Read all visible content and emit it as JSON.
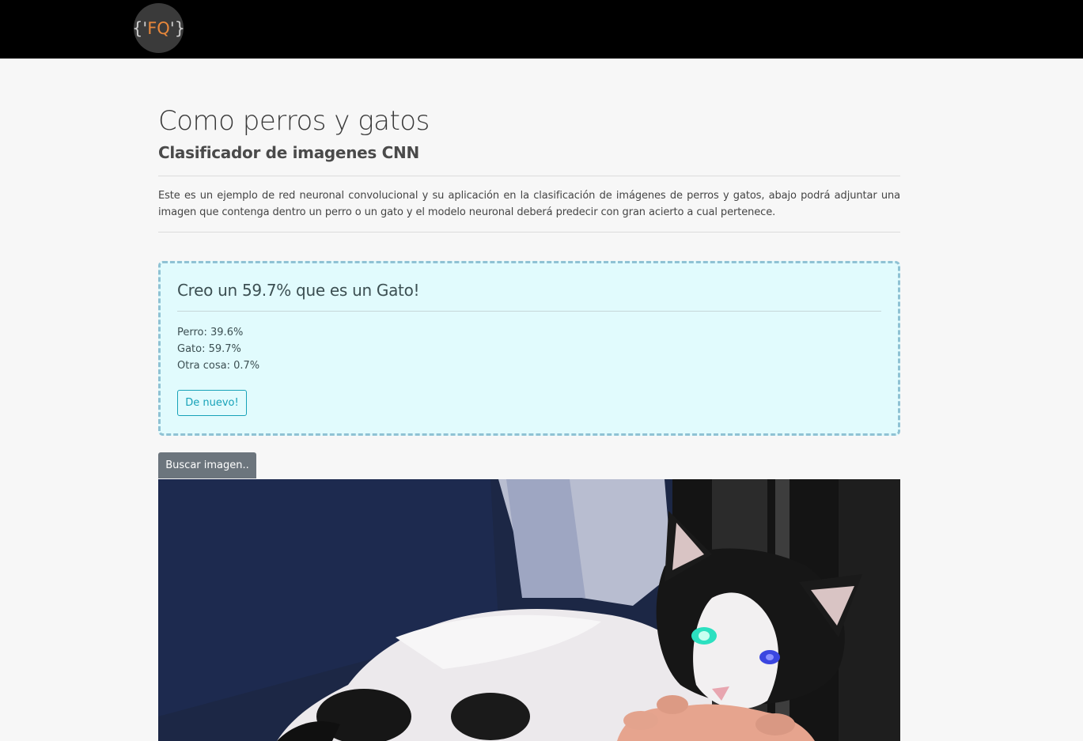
{
  "navbar": {
    "logo": {
      "open_brace": "{'",
      "letters": "FQ",
      "close_brace": "'}"
    }
  },
  "header": {
    "title": "Como perros y gatos",
    "subtitle": "Clasificador de imagenes CNN"
  },
  "description": "Este es un ejemplo de red neuronal convolucional y su aplicación en la clasificación de imágenes de perros y gatos, abajo podrá adjuntar una imagen que contenga dentro un perro o un gato y el modelo neuronal deberá predecir con gran acierto a cual pertenece.",
  "result": {
    "headline": "Creo un 59.7% que es un Gato!",
    "lines": [
      {
        "label": "Perro: 39.6%"
      },
      {
        "label": "Gato: 59.7%"
      },
      {
        "label": "Otra cosa: 0.7%"
      }
    ],
    "retry_label": "De nuevo!"
  },
  "upload": {
    "button_label": "Buscar imagen.."
  },
  "colors": {
    "navbar": "#000000",
    "logo_accent": "#e8873a",
    "result_bg": "#e1fbfd",
    "result_border": "#8fc2d4",
    "retry_accent": "#17a2b8",
    "search_button": "#6c757d"
  }
}
